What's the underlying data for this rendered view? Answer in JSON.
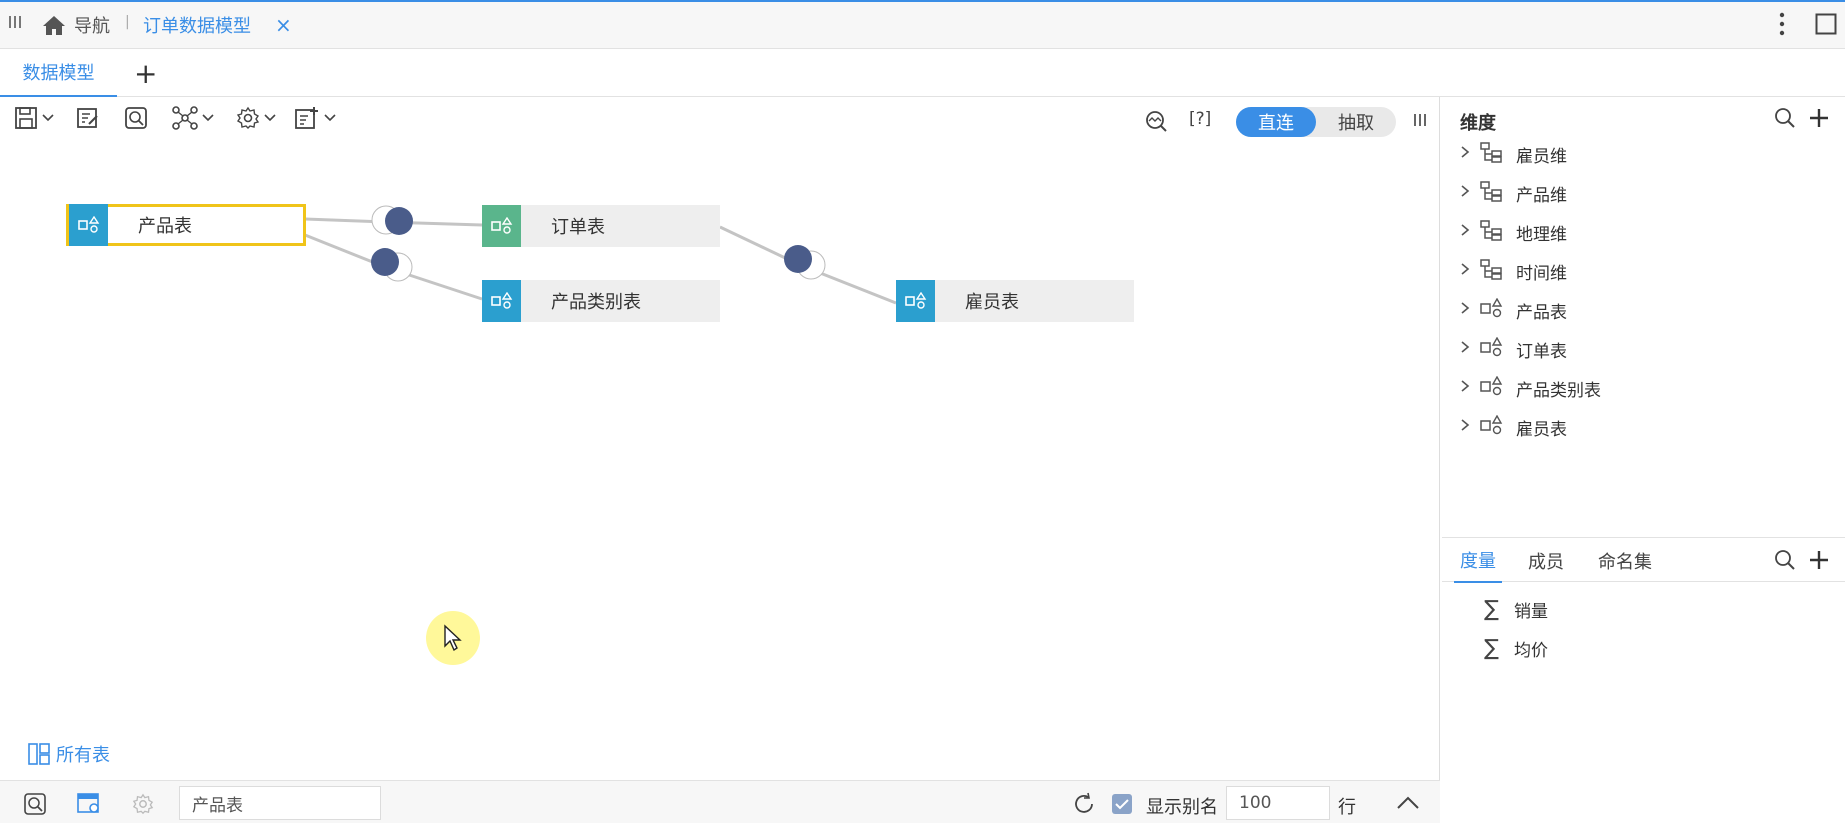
{
  "nav": {
    "menu_icon": "grip-lines-icon",
    "home_label": "导航",
    "separator": "|",
    "active_tab_label": "订单数据模型",
    "close_glyph": "×"
  },
  "tabs": {
    "active_label": "数据模型",
    "add_glyph": "+"
  },
  "toolbar": {
    "help_label": "[?]",
    "mode_on": "直连",
    "mode_off": "抽取"
  },
  "canvas": {
    "nodes": [
      {
        "label": "产品表",
        "selected": true,
        "icon_color": "#2b9fcf"
      },
      {
        "label": "订单表",
        "selected": false,
        "icon_color": "#5ab58c"
      },
      {
        "label": "产品类别表",
        "selected": false,
        "icon_color": "#2b9fcf"
      },
      {
        "label": "雇员表",
        "selected": false,
        "icon_color": "#2b9fcf"
      }
    ],
    "all_tables_label": "所有表"
  },
  "right_panel": {
    "dimension_title": "维度",
    "dimensions": [
      {
        "label": "雇员维",
        "icon": "hierarchy-icon"
      },
      {
        "label": "产品维",
        "icon": "hierarchy-icon"
      },
      {
        "label": "地理维",
        "icon": "hierarchy-icon"
      },
      {
        "label": "时间维",
        "icon": "hierarchy-icon"
      },
      {
        "label": "产品表",
        "icon": "table-dim-icon"
      },
      {
        "label": "订单表",
        "icon": "table-dim-icon"
      },
      {
        "label": "产品类别表",
        "icon": "table-dim-icon"
      },
      {
        "label": "雇员表",
        "icon": "table-dim-icon"
      }
    ],
    "tabs": [
      {
        "label": "度量",
        "active": true
      },
      {
        "label": "成员",
        "active": false
      },
      {
        "label": "命名集",
        "active": false
      }
    ],
    "measures": [
      {
        "symbol": "∑",
        "label": "销量"
      },
      {
        "symbol": "∑",
        "label": "均价"
      }
    ]
  },
  "bottom": {
    "table_input_value": "产品表",
    "show_alias_label": "显示别名",
    "show_alias_checked": true,
    "rows_value": "100",
    "rows_unit": "行"
  },
  "colors": {
    "accent": "#3a8ee6",
    "join_dot": "#4a5c8a",
    "selection": "#f0c419"
  }
}
